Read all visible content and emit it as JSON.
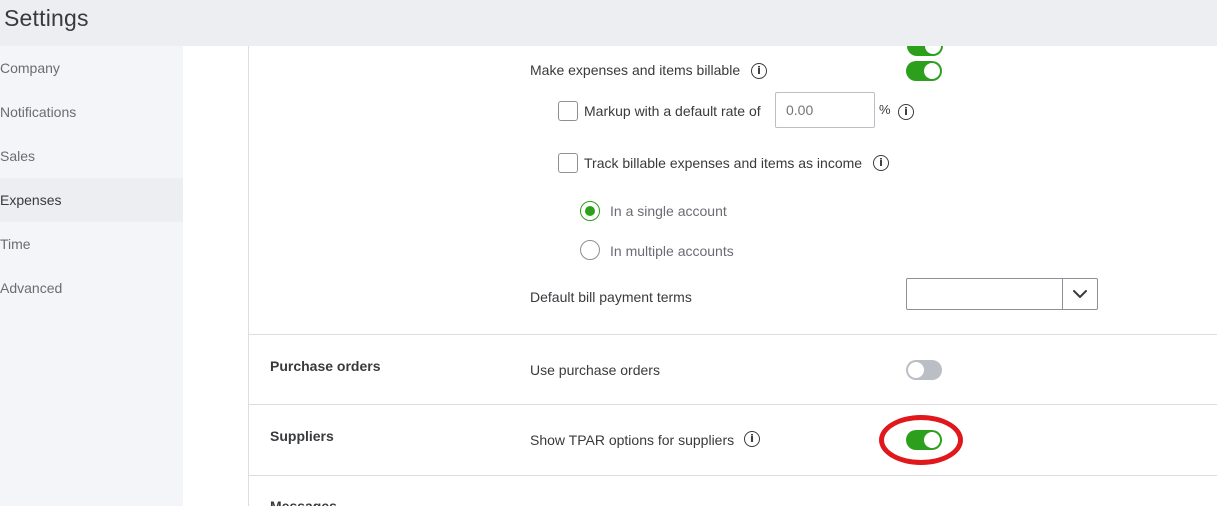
{
  "header": {
    "title": "Settings"
  },
  "sidebar": {
    "items": [
      {
        "label": "Company",
        "active": false
      },
      {
        "label": "Notifications",
        "active": false
      },
      {
        "label": "Sales",
        "active": false
      },
      {
        "label": "Expenses",
        "active": true
      },
      {
        "label": "Time",
        "active": false
      },
      {
        "label": "Advanced",
        "active": false
      }
    ]
  },
  "bills_section": {
    "make_billable_label": "Make expenses and items billable",
    "make_billable_on": true,
    "markup_label": "Markup with a default rate of",
    "markup_checked": false,
    "markup_placeholder": "0.00",
    "markup_unit": "%",
    "track_label": "Track billable expenses and items as income",
    "track_checked": false,
    "radio_single_label": "In a single account",
    "radio_single_checked": true,
    "radio_multiple_label": "In multiple accounts",
    "radio_multiple_checked": false,
    "payment_terms_label": "Default bill payment terms",
    "payment_terms_value": ""
  },
  "purchase_orders": {
    "title": "Purchase orders",
    "use_label": "Use purchase orders",
    "use_on": false
  },
  "suppliers": {
    "title": "Suppliers",
    "tpar_label": "Show TPAR options for suppliers",
    "tpar_on": true
  },
  "messages": {
    "title": "Messages"
  },
  "colors": {
    "accent_green": "#2ca01c",
    "highlight_red": "#e0171b"
  },
  "icons": {
    "info": "info-icon",
    "dropdown": "chevron-down-icon"
  }
}
